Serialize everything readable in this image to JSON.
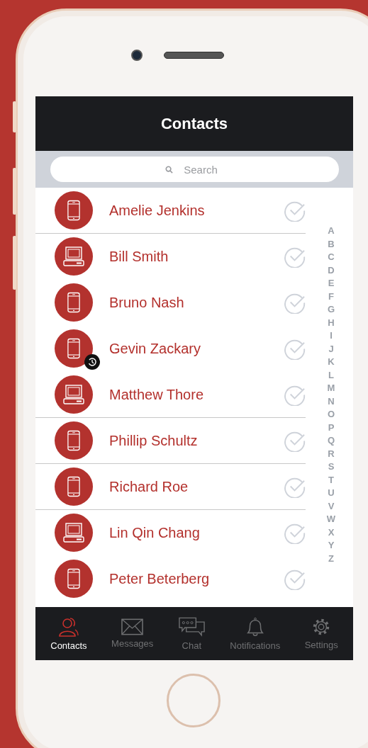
{
  "header": {
    "title": "Contacts"
  },
  "search": {
    "placeholder": "Search"
  },
  "contacts": [
    {
      "name": "Amelie Jenkins",
      "kind": "phone",
      "recent": false,
      "divider_below": true
    },
    {
      "name": "Bill Smith",
      "kind": "computer",
      "recent": false,
      "divider_below": false
    },
    {
      "name": "Bruno Nash",
      "kind": "phone",
      "recent": false,
      "divider_below": false
    },
    {
      "name": "Gevin Zackary",
      "kind": "phone",
      "recent": true,
      "divider_below": false
    },
    {
      "name": "Matthew Thore",
      "kind": "computer",
      "recent": false,
      "divider_below": true
    },
    {
      "name": "Phillip Schultz",
      "kind": "phone",
      "recent": false,
      "divider_below": true
    },
    {
      "name": "Richard Roe",
      "kind": "phone",
      "recent": false,
      "divider_below": true
    },
    {
      "name": "Lin Qin Chang",
      "kind": "computer",
      "recent": false,
      "divider_below": false
    },
    {
      "name": "Peter Beterberg",
      "kind": "phone",
      "recent": false,
      "divider_below": false
    }
  ],
  "index_letters": [
    "A",
    "B",
    "C",
    "D",
    "E",
    "F",
    "G",
    "H",
    "I",
    "J",
    "K",
    "L",
    "M",
    "N",
    "O",
    "P",
    "Q",
    "R",
    "S",
    "T",
    "U",
    "V",
    "W",
    "X",
    "Y",
    "Z"
  ],
  "tabs": [
    {
      "label": "Contacts",
      "kind": "contacts",
      "selected": true
    },
    {
      "label": "Messages",
      "kind": "messages",
      "selected": false
    },
    {
      "label": "Chat",
      "kind": "chat",
      "selected": false
    },
    {
      "label": "Notifications",
      "kind": "notifications",
      "selected": false
    },
    {
      "label": "Settings",
      "kind": "settings",
      "selected": false
    }
  ]
}
